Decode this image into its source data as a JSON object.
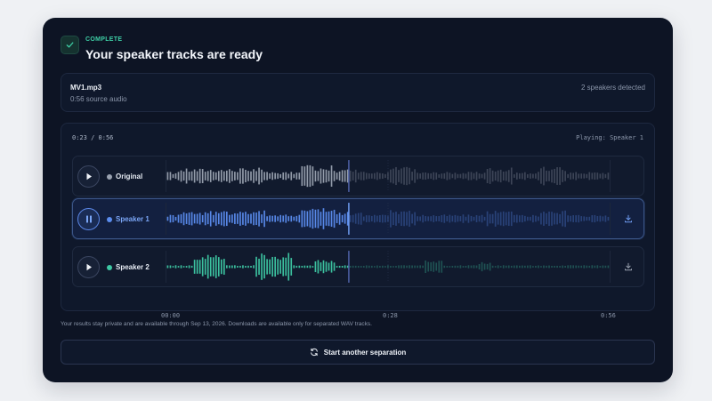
{
  "header": {
    "status": "COMPLETE",
    "title": "Your speaker tracks are ready"
  },
  "file": {
    "name": "MV1.mp3",
    "duration": "0:56 source audio",
    "speakers_detected": "2 speakers detected"
  },
  "player": {
    "elapsed": "0:23",
    "separator": "/",
    "total": "0:56",
    "playing": "Playing: Speaker 1",
    "progress_fraction": 0.41,
    "axis_labels": [
      "00:00",
      "0:28",
      "0:56"
    ],
    "tracks": [
      {
        "label": "Original",
        "color": "#9aa2b0",
        "active": false,
        "downloadable": false,
        "state": "play"
      },
      {
        "label": "Speaker 1",
        "color": "#5b8def",
        "active": true,
        "downloadable": true,
        "state": "pause"
      },
      {
        "label": "Speaker 2",
        "color": "#3ec9a4",
        "active": false,
        "downloadable": true,
        "state": "play"
      }
    ]
  },
  "footer": {
    "privacy_note": "Your results stay private and are available through Sep 13, 2026. Downloads are available only for separated WAV tracks.",
    "restart_label": "Start another separation"
  },
  "icons": {
    "status": "check-icon",
    "play": "play-icon",
    "pause": "pause-icon",
    "download": "download-icon",
    "restart": "refresh-icon"
  }
}
